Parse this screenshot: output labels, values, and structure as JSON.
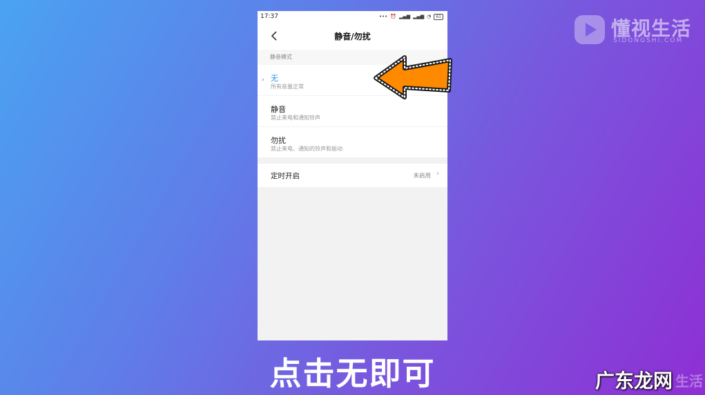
{
  "status": {
    "time": "17:37",
    "battery": "61"
  },
  "header": {
    "title": "静音/勿扰",
    "back_icon": "chevron-left-icon"
  },
  "section": {
    "label": "静音模式"
  },
  "modes": [
    {
      "title": "无",
      "subtitle": "所有音量正常",
      "selected": true
    },
    {
      "title": "静音",
      "subtitle": "禁止来电和通知铃声",
      "selected": false
    },
    {
      "title": "勿扰",
      "subtitle": "禁止来电、通知的铃声和振动",
      "selected": false
    }
  ],
  "timer": {
    "label": "定时开启",
    "value": "未启用"
  },
  "caption": "点击无即可",
  "logo": {
    "name": "懂视生活",
    "domain": "SIDONGSHI.COM"
  },
  "watermark": {
    "text": "广东龙网",
    "ghost": "生活"
  },
  "colors": {
    "accent": "#2a8fe8",
    "arrow": "#ff8a00"
  }
}
